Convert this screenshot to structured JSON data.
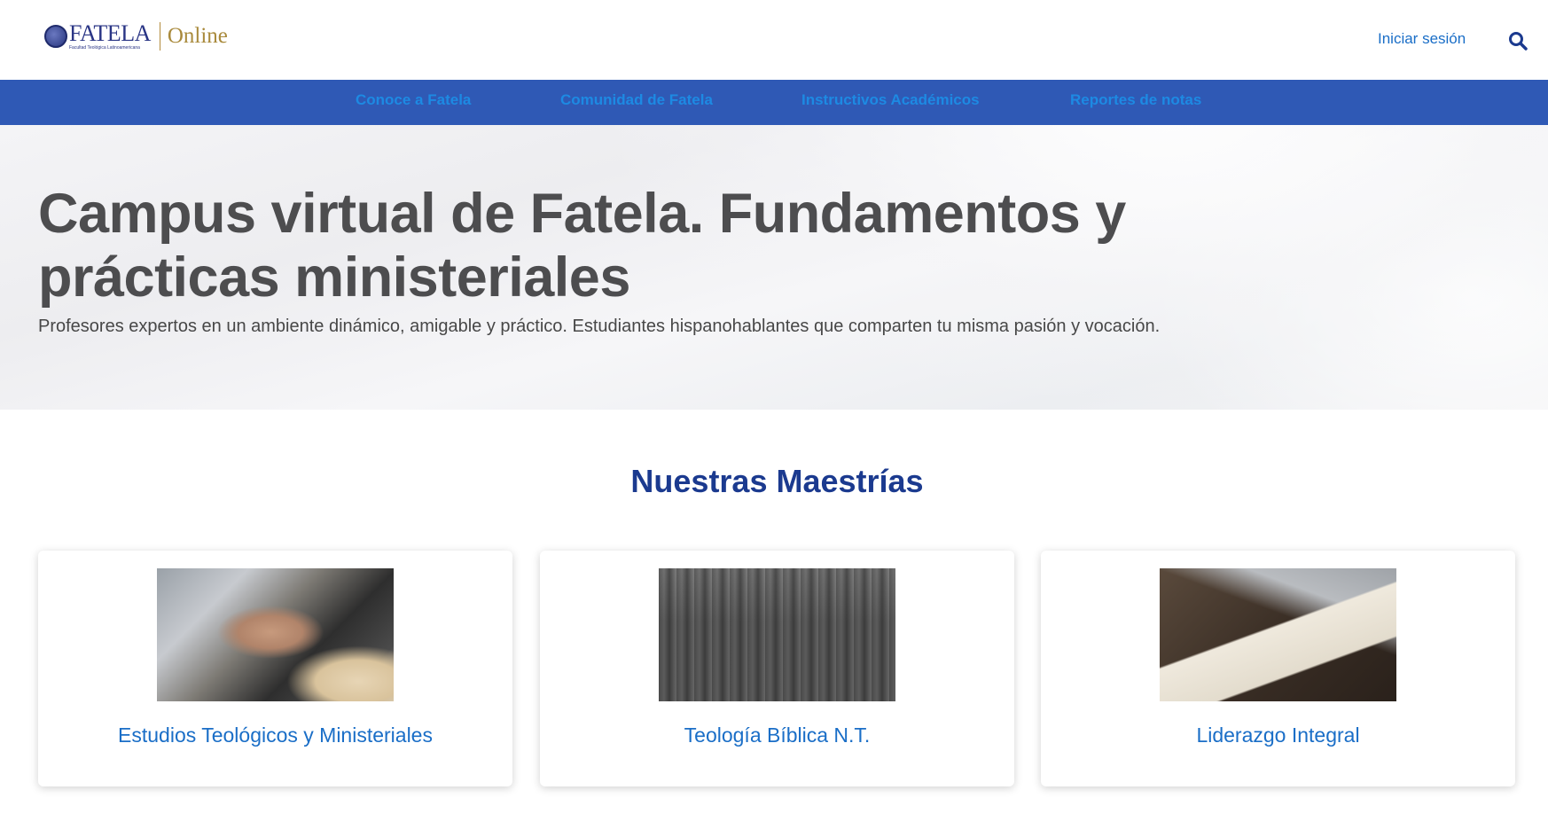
{
  "header": {
    "logo_text": "FATELA",
    "logo_subtext": "Facultad Teológica Latinoamericana",
    "logo_online": "Online",
    "login_label": "Iniciar sesión"
  },
  "nav": {
    "items": [
      {
        "label": "Conoce a Fatela"
      },
      {
        "label": "Comunidad de Fatela"
      },
      {
        "label": "Instructivos Académicos"
      },
      {
        "label": "Reportes de notas"
      }
    ]
  },
  "hero": {
    "title": "Campus virtual de Fatela. Fundamentos y prácticas ministeriales",
    "subtitle": "Profesores expertos en un ambiente dinámico, amigable y práctico. Estudiantes hispanohablantes que comparten tu misma pasión y vocación."
  },
  "section": {
    "title": "Nuestras Maestrías"
  },
  "cards": [
    {
      "title": "Estudios Teológicos y Ministeriales",
      "image": "hands-together-photo"
    },
    {
      "title": "Teología Bíblica N.T.",
      "image": "parthenon-photo"
    },
    {
      "title": "Liderazgo Integral",
      "image": "laptop-notebook-photo"
    }
  ],
  "colors": {
    "navbar": "#2f59b5",
    "nav_text": "#1d8ae3",
    "link": "#1a6ec7",
    "section_title": "#1b3a8f",
    "hero_title": "#4d4d4f"
  },
  "icons": {
    "search": "search-icon"
  }
}
